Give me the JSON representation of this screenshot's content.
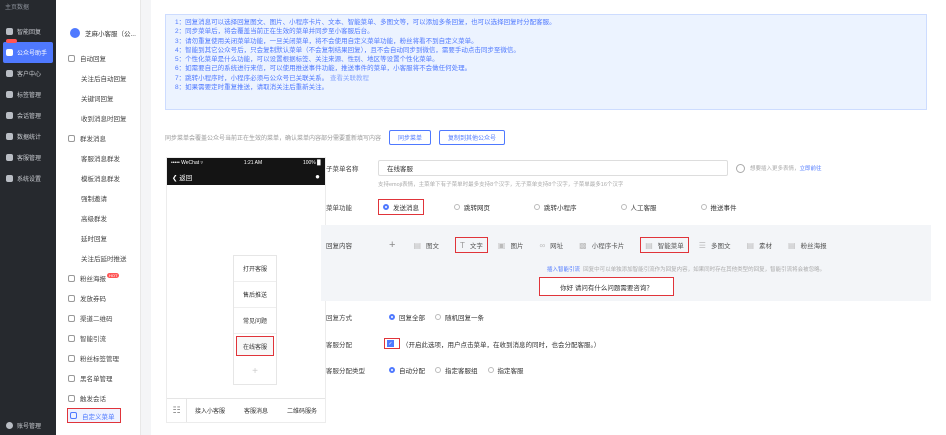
{
  "leftnav": {
    "top": "主页数据",
    "items": [
      {
        "label": "智能回复",
        "icon": "send-icon"
      },
      {
        "label": "公众号助手",
        "icon": "chat-icon",
        "active": true
      },
      {
        "label": "客户中心",
        "icon": "users-icon"
      },
      {
        "label": "标签管理",
        "icon": "tag-icon"
      },
      {
        "label": "会话管理",
        "icon": "chat-bubble-icon"
      },
      {
        "label": "数据统计",
        "icon": "bar-chart-icon"
      },
      {
        "label": "客服管理",
        "icon": "headset-icon"
      },
      {
        "label": "系统设置",
        "icon": "gear-icon"
      }
    ],
    "bottom": "账号管理"
  },
  "subnav": {
    "account": "芝麻小客服（公...",
    "items": [
      {
        "label": "自动回复",
        "type": "parent"
      },
      {
        "label": "关注后自动回复",
        "type": "child"
      },
      {
        "label": "关键词回复",
        "type": "child"
      },
      {
        "label": "收到消息时回复",
        "type": "child"
      },
      {
        "label": "群发消息",
        "type": "parent"
      },
      {
        "label": "客服消息群发",
        "type": "child"
      },
      {
        "label": "模板消息群发",
        "type": "child"
      },
      {
        "label": "强制邀请",
        "type": "child"
      },
      {
        "label": "高级群发",
        "type": "child"
      },
      {
        "label": "延时回复",
        "type": "child"
      },
      {
        "label": "关注后延时推送",
        "type": "child"
      },
      {
        "label": "粉丝海报",
        "type": "parent",
        "badge": "HOT"
      },
      {
        "label": "发放券码",
        "type": "parent"
      },
      {
        "label": "渠道二维码",
        "type": "parent"
      },
      {
        "label": "智能引流",
        "type": "parent"
      },
      {
        "label": "粉丝标签管理",
        "type": "parent"
      },
      {
        "label": "黑名单管理",
        "type": "parent"
      },
      {
        "label": "触发会话",
        "type": "parent"
      },
      {
        "label": "自定义菜单",
        "type": "selected"
      }
    ]
  },
  "notice": [
    "1：回复消息可以选择回复图文、图片、小程序卡片、文本、智能菜单、多图文等，可以添加多条回复，也可以选择回复时分配客服。",
    "2：同步菜单后，将会覆盖当前正在生效的菜单并同步至小客服后台。",
    "3：请勿重复使用关闭菜单功能，一旦关闭菜单，将不会使用自定义菜单功能，粉丝将看不到自定义菜单。",
    "4：智能到其它公众号后，只会复制默认菜单（不会复制结果回复），且不会自动同步到微信，需要手动点击同步至微信。",
    "5：个性化菜单是什么功能，可以设置根据标签、关注来源、性别、地区等设置个性化菜单。",
    "6：如需要自己的系统进行来信，可以使用推送事件功能，推送事件的菜单，小客服将不会做任何处理。",
    "7：跳转小程序时，小程序必须与公众号已关联关系。",
    "8：如果需要定时重复推送，请取消关注后重新关注。"
  ],
  "notice_link": "查看关联教程",
  "sync": {
    "desc": "同步菜单会覆盖公众号当前正在生效的菜单，确认菜单内容部分需要重新填写内容",
    "btn_sync": "同步菜单",
    "btn_copy": "复制到其他公众号"
  },
  "phone": {
    "carrier": "••••• WeChat ▿",
    "time": "1:21 AM",
    "battery": "100% ▉",
    "back": "返回",
    "menu": [
      "打开客服",
      "售后推送",
      "常见问题",
      "在线客服",
      "+"
    ],
    "footer": [
      "接入小客服",
      "客服消息",
      "二维码服务"
    ]
  },
  "form": {
    "name_label": "子菜单名称",
    "name_value": "在线客服",
    "name_tip": "支持emoji表情，主菜单下有子菜单时最多支持8个汉字，无子菜单支持8个汉字，子菜单最多16个汉字",
    "emoji_tip": "想要插入更多表情，",
    "emoji_link": "立即前往",
    "func_label": "菜单功能",
    "func_options": [
      "发送消息",
      "跳转网页",
      "跳转小程序",
      "人工客服",
      "推送事件"
    ],
    "content_label": "回复内容",
    "content_types": [
      {
        "label": "图文",
        "icon": "article-icon"
      },
      {
        "label": "文字",
        "icon": "text-icon"
      },
      {
        "label": "图片",
        "icon": "image-icon"
      },
      {
        "label": "网址",
        "icon": "link-icon"
      },
      {
        "label": "小程序卡片",
        "icon": "miniapp-icon"
      },
      {
        "label": "智能菜单",
        "icon": "menu-icon"
      },
      {
        "label": "多图文",
        "icon": "multi-article-icon"
      },
      {
        "label": "素材",
        "icon": "material-icon"
      },
      {
        "label": "粉丝海报",
        "icon": "poster-icon"
      }
    ],
    "hint_link": "插入智能引流",
    "hint_text": "回复中可以单独添加智能引流作为回复内容，如果同时存在其他类型的回复，智能引流将会被忽略。",
    "reply_msg": "你好 请问有什么问题需要咨询？",
    "mode_label": "回复方式",
    "mode_options": [
      "回复全部",
      "随机回复一条"
    ],
    "assign_label": "客服分配",
    "assign_text": "（开启此选项，用户点击菜单，在收到消息的同时，也会分配客服。）",
    "type_label": "客服分配类型",
    "type_options": [
      "自动分配",
      "指定客服组",
      "指定客服"
    ]
  },
  "colors": {
    "accent": "#4f79ff",
    "highlight": "#e0343a",
    "sidebar": "#26292e"
  }
}
